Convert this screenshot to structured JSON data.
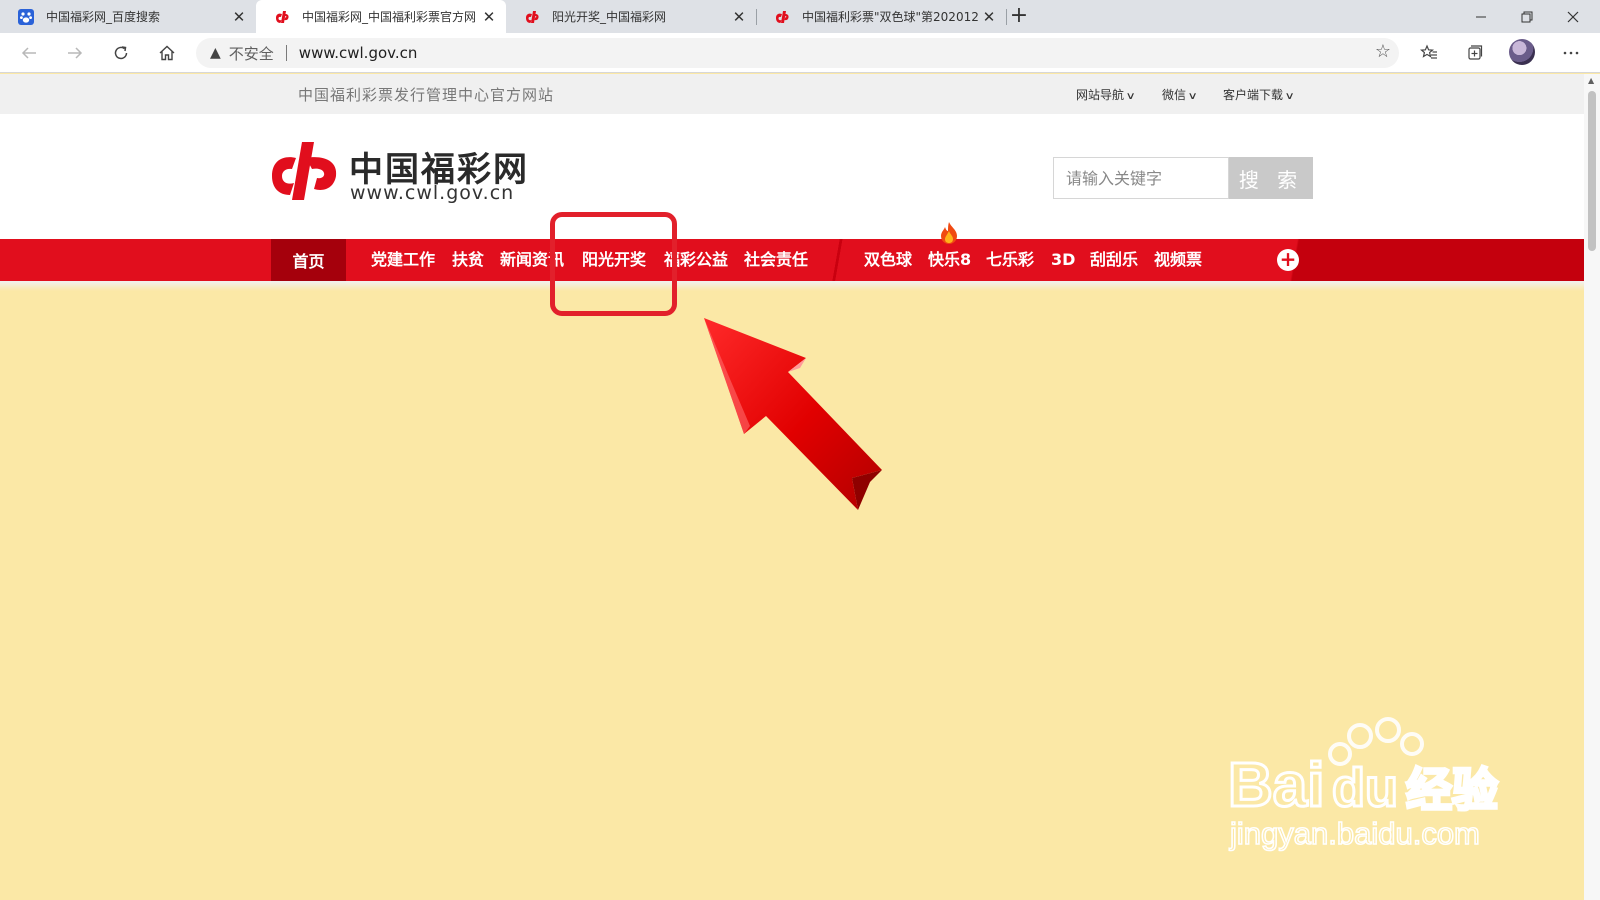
{
  "browser": {
    "tabs": [
      {
        "title": "中国福彩网_百度搜索",
        "icon": "baidu-paw-icon",
        "active": false
      },
      {
        "title": "中国福彩网_中国福利彩票官方网",
        "icon": "cwl-logo-icon",
        "active": true
      },
      {
        "title": "阳光开奖_中国福彩网",
        "icon": "cwl-logo-icon",
        "active": false
      },
      {
        "title": "中国福利彩票\"双色球\"第202012",
        "icon": "cwl-logo-icon",
        "active": false
      }
    ],
    "address": {
      "security_label": "不安全",
      "url": "www.cwl.gov.cn"
    }
  },
  "site": {
    "tagline": "中国福利彩票发行管理中心官方网站",
    "top_links": [
      "网站导航",
      "微信",
      "客户端下载"
    ],
    "logo": {
      "name": "中国福彩网",
      "url": "www.cwl.gov.cn"
    },
    "search": {
      "placeholder": "请输入关键字",
      "button_label": "搜 索"
    },
    "nav": {
      "home": "首页",
      "items": [
        "党建工作",
        "扶贫",
        "新闻资讯",
        "阳光开奖",
        "福彩公益",
        "社会责任",
        "双色球",
        "快乐8",
        "七乐彩",
        "3D",
        "刮刮乐",
        "视频票"
      ]
    }
  },
  "watermark": {
    "brand": "Bai",
    "brand_suffix": "du",
    "cn": "经验",
    "url": "jingyan.baidu.com"
  },
  "colors": {
    "nav_red": "#e10e1d",
    "nav_home_dark": "#a5000c",
    "page_background": "#fbe8a6",
    "highlight": "#e2202b"
  }
}
